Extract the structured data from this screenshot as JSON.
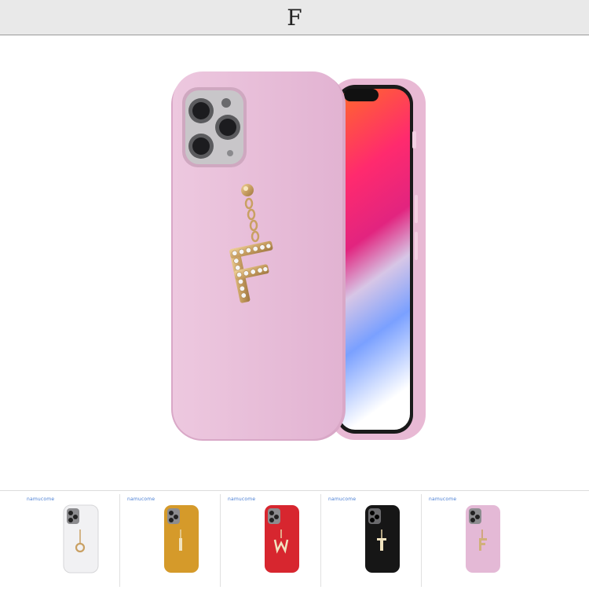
{
  "header": {
    "title": "F"
  },
  "hero": {
    "case_color": "#e7bcd8",
    "charm_letter": "F",
    "charm_color": "#c9a063"
  },
  "thumbnails": [
    {
      "brand": "namucome",
      "case_color": "#f1f1f3",
      "charm_letter": "O"
    },
    {
      "brand": "namucome",
      "case_color": "#d59a2a",
      "charm_letter": "I"
    },
    {
      "brand": "namucome",
      "case_color": "#d7262f",
      "charm_letter": "W"
    },
    {
      "brand": "namucome",
      "case_color": "#161616",
      "charm_letter": "T"
    },
    {
      "brand": "namucome",
      "case_color": "#e4b9d6",
      "charm_letter": "F"
    }
  ]
}
